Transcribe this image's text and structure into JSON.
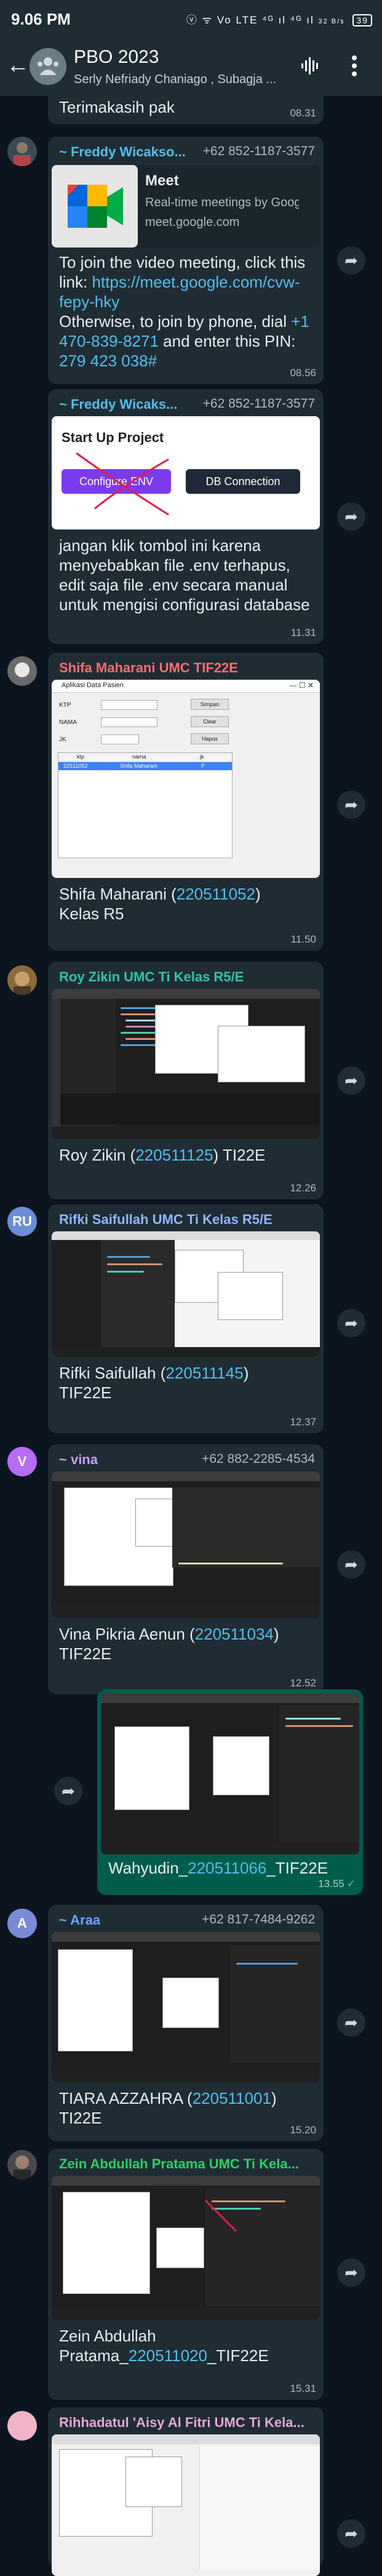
{
  "status_bar": {
    "time": "9.06 PM",
    "icons": "ⓥ ᯤ Vo LTE ⁴ᴳ ıl ⁴ᴳ ıl",
    "data_rate": "32 B/s",
    "battery": "39"
  },
  "header": {
    "title": "PBO 2023",
    "subtitle": "Serly Nefriady Chaniago , Subagja ..."
  },
  "messages": [
    {
      "text": "Terimakasih pak",
      "time": "08.31"
    },
    {
      "sender": "~ Freddy Wicakso...",
      "phone": "+62 852-1187-3577",
      "preview": {
        "title": "Meet",
        "desc": "Real-time meetings by Goog...",
        "domain": "meet.google.com"
      },
      "text_a": "To join the video meeting, click this link: ",
      "link": "https://meet.google.com/cvw-fepy-hky",
      "text_b": "Otherwise, to join by phone, dial ",
      "phone_link": "+1 470-839-8271",
      "text_c": " and enter this PIN: ",
      "pin": "279 423 038#",
      "time": "08.56"
    },
    {
      "sender": "~ Freddy Wicaks...",
      "phone": "+62 852-1187-3577",
      "card": {
        "title": "Start Up Project",
        "btn1": "Configure ENV",
        "btn2": "DB Connection"
      },
      "text": "jangan klik tombol ini karena menyebabkan file .env terhapus, edit saja file .env secara manual untuk mengisi configurasi database",
      "time": "11.31"
    },
    {
      "sender": "Shifa Maharani UMC TIF22E",
      "window": {
        "title": "Aplikasi Data Pasien",
        "lbl1": "KTP",
        "lbl2": "NAMA",
        "lbl3": "JK",
        "b1": "Simpan",
        "b2": "Clear",
        "b3": "Hapus",
        "col1": "ktp",
        "col2": "nama",
        "col3": "jk",
        "r1c1": "22511052",
        "r1c2": "Shifa Maharani",
        "r1c3": "P"
      },
      "text_a": "Shifa Maharani (",
      "nim": "220511052",
      "text_b": ")\nKelas R5",
      "time": "11.50"
    },
    {
      "sender": "Roy Zikin UMC Ti Kelas R5/E",
      "text_a": "Roy Zikin (",
      "nim": "220511125",
      "text_b": ") TI22E",
      "time": "12.26"
    },
    {
      "sender": "Rifki Saifullah UMC Ti Kelas R5/E",
      "initials": "RU",
      "text_a": "Rifki Saifullah (",
      "nim": "220511145",
      "text_b": ")\nTIF22E",
      "time": "12.37"
    },
    {
      "sender": "~ vina",
      "initials": "V",
      "phone": "+62 882-2285-4534",
      "text_a": "Vina Pikria Aenun (",
      "nim": "220511034",
      "text_b": ")\nTIF22E",
      "time": "12.52"
    },
    {
      "text_a": "Wahyudin_",
      "nim": "220511066",
      "text_b": "_TIF22E",
      "time": "13.55",
      "checks": "✓"
    },
    {
      "sender": "~ Araa",
      "initials": "A",
      "phone": "+62 817-7484-9262",
      "text_a": "TIARA AZZAHRA (",
      "nim": "220511001",
      "text_b": ")\nTI22E",
      "time": "15.20"
    },
    {
      "sender": "Zein Abdullah Pratama UMC Ti Kela...",
      "text_a": "Zein Abdullah\nPratama_",
      "nim": "220511020",
      "text_b": "_TIF22E",
      "time": "15.31"
    },
    {
      "sender": "Rihhadatul 'Aisy Al Fitri UMC Ti Kela..."
    }
  ],
  "colors": {
    "bg": "#0c1420",
    "bubble_in": "#1f2c34",
    "bubble_out": "#005c4b",
    "sender_freddy": "#53bdeb",
    "sender_shifa": "#ff6b73",
    "sender_roy": "#2ec4a5",
    "sender_rifki": "#8fb5ff",
    "sender_vina": "#c79ef9",
    "sender_araa": "#6ba6ff",
    "sender_zein": "#25d366",
    "sender_rihha": "#e6a5d8",
    "link": "#53bdeb"
  },
  "icons": [
    "back-arrow-icon",
    "group-avatar-icon",
    "voice-wave-icon",
    "more-vert-icon",
    "forward-icon",
    "google-meet-icon",
    "checkmark-icon"
  ]
}
